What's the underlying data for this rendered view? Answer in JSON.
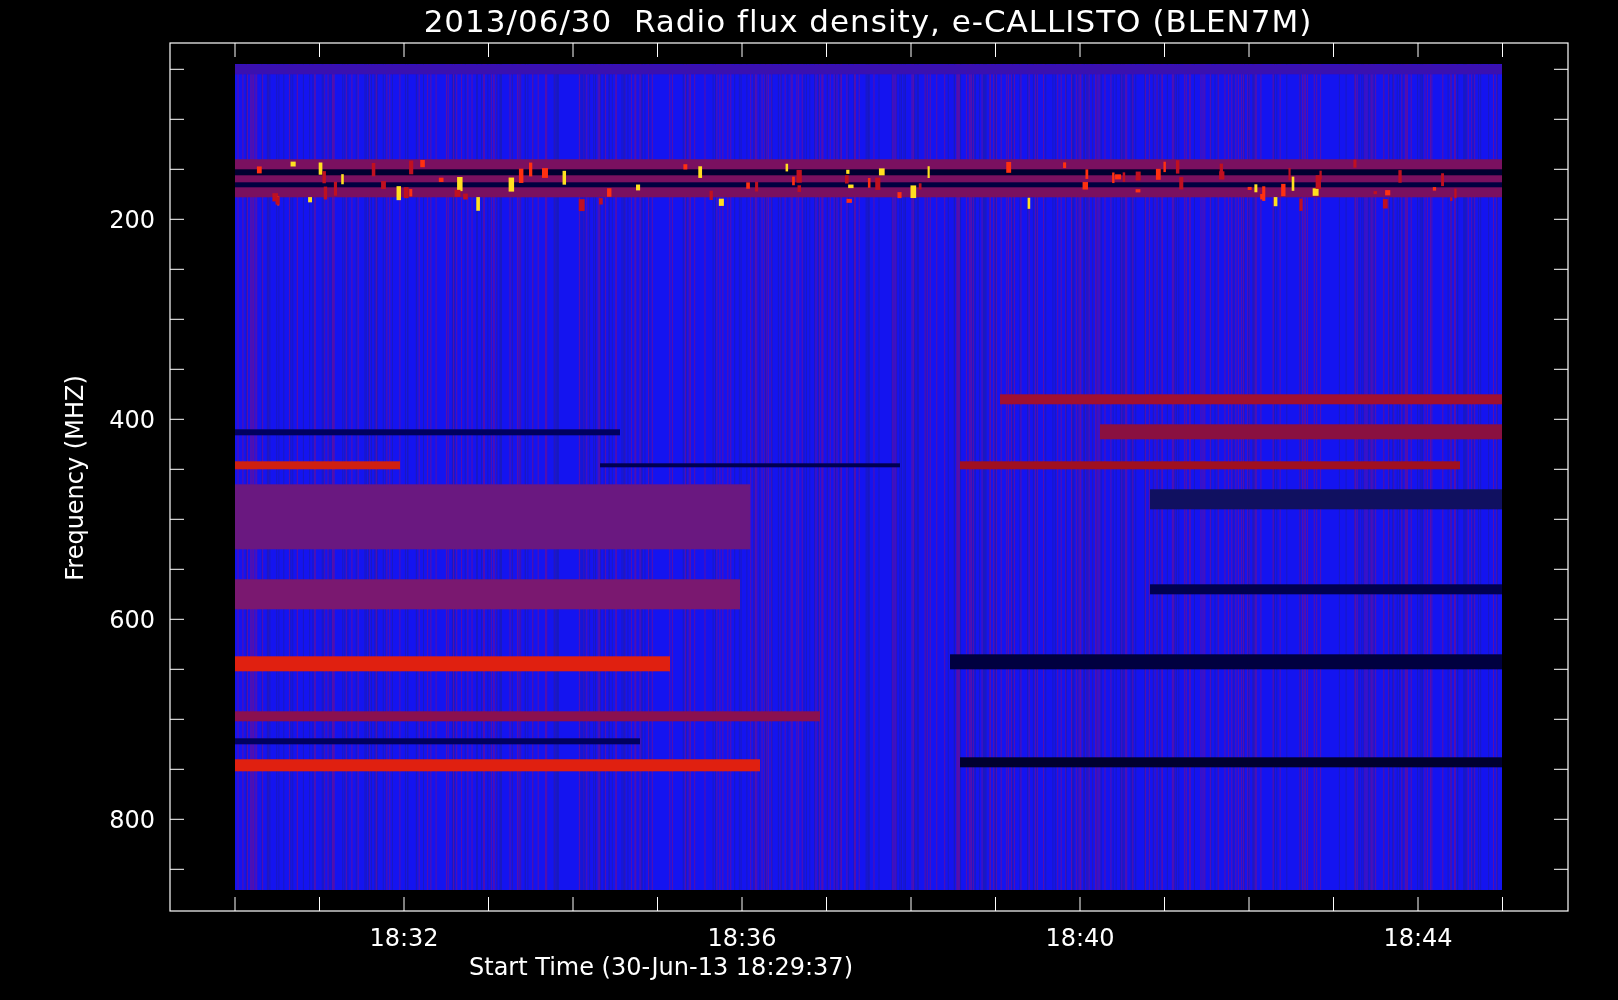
{
  "title": "2013/06/30  Radio flux density, e-CALLISTO (BLEN7M)",
  "y_axis": {
    "label": "Frequency (MHZ)",
    "ticks": [
      "200",
      "400",
      "600",
      "800"
    ]
  },
  "x_axis": {
    "label": "Start Time (30-Jun-13 18:29:37)",
    "ticks": [
      "18:32",
      "18:36",
      "18:40",
      "18:44"
    ]
  }
}
